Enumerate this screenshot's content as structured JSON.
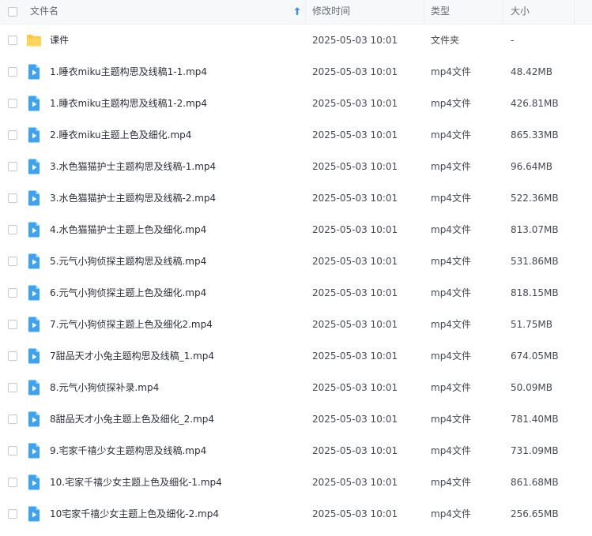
{
  "columns": {
    "name": "文件名",
    "modified": "修改时间",
    "type": "类型",
    "size": "大小"
  },
  "icons": {
    "folder_color": "#ffc83d",
    "video_color": "#3fa2ef"
  },
  "files": [
    {
      "name": "课件",
      "modified": "2025-05-03 10:01",
      "type": "文件夹",
      "size": "-",
      "icon": "folder-icon"
    },
    {
      "name": "1.睡衣miku主题构思及线稿1-1.mp4",
      "modified": "2025-05-03 10:01",
      "type": "mp4文件",
      "size": "48.42MB",
      "icon": "video-file-icon"
    },
    {
      "name": "1.睡衣miku主题构思及线稿1-2.mp4",
      "modified": "2025-05-03 10:01",
      "type": "mp4文件",
      "size": "426.81MB",
      "icon": "video-file-icon"
    },
    {
      "name": "2.睡衣miku主题上色及细化.mp4",
      "modified": "2025-05-03 10:01",
      "type": "mp4文件",
      "size": "865.33MB",
      "icon": "video-file-icon"
    },
    {
      "name": "3.水色猫猫护士主题构思及线稿-1.mp4",
      "modified": "2025-05-03 10:01",
      "type": "mp4文件",
      "size": "96.64MB",
      "icon": "video-file-icon"
    },
    {
      "name": "3.水色猫猫护士主题构思及线稿-2.mp4",
      "modified": "2025-05-03 10:01",
      "type": "mp4文件",
      "size": "522.36MB",
      "icon": "video-file-icon"
    },
    {
      "name": "4.水色猫猫护士主题上色及细化.mp4",
      "modified": "2025-05-03 10:01",
      "type": "mp4文件",
      "size": "813.07MB",
      "icon": "video-file-icon"
    },
    {
      "name": "5.元气小狗侦探主题构思及线稿.mp4",
      "modified": "2025-05-03 10:01",
      "type": "mp4文件",
      "size": "531.86MB",
      "icon": "video-file-icon"
    },
    {
      "name": "6.元气小狗侦探主题上色及细化.mp4",
      "modified": "2025-05-03 10:01",
      "type": "mp4文件",
      "size": "818.15MB",
      "icon": "video-file-icon"
    },
    {
      "name": "7.元气小狗侦探主题上色及细化2.mp4",
      "modified": "2025-05-03 10:01",
      "type": "mp4文件",
      "size": "51.75MB",
      "icon": "video-file-icon"
    },
    {
      "name": "7甜品天才小兔主题构思及线稿_1.mp4",
      "modified": "2025-05-03 10:01",
      "type": "mp4文件",
      "size": "674.05MB",
      "icon": "video-file-icon"
    },
    {
      "name": "8.元气小狗侦探补录.mp4",
      "modified": "2025-05-03 10:01",
      "type": "mp4文件",
      "size": "50.09MB",
      "icon": "video-file-icon"
    },
    {
      "name": "8甜品天才小兔主题上色及细化_2.mp4",
      "modified": "2025-05-03 10:01",
      "type": "mp4文件",
      "size": "781.40MB",
      "icon": "video-file-icon"
    },
    {
      "name": "9.宅家千禧少女主题构思及线稿.mp4",
      "modified": "2025-05-03 10:01",
      "type": "mp4文件",
      "size": "731.09MB",
      "icon": "video-file-icon"
    },
    {
      "name": "10.宅家千禧少女主题上色及细化-1.mp4",
      "modified": "2025-05-03 10:01",
      "type": "mp4文件",
      "size": "861.68MB",
      "icon": "video-file-icon"
    },
    {
      "name": "10宅家千禧少女主题上色及细化-2.mp4",
      "modified": "2025-05-03 10:01",
      "type": "mp4文件",
      "size": "256.65MB",
      "icon": "video-file-icon"
    }
  ]
}
